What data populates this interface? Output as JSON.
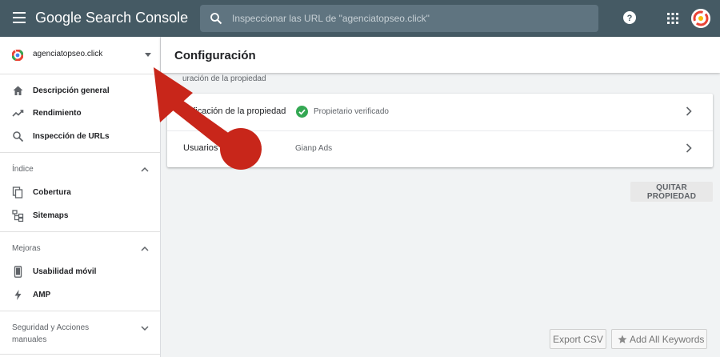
{
  "app": {
    "brand": "Google Search Console"
  },
  "search": {
    "placeholder": "Inspeccionar las URL de \"agenciatopseo.click\""
  },
  "property": {
    "name": "agenciatopseo.click"
  },
  "sidebar": {
    "items": [
      {
        "label": "Descripción general",
        "icon": "home-icon"
      },
      {
        "label": "Rendimiento",
        "icon": "trending-up-icon"
      },
      {
        "label": "Inspección de URLs",
        "icon": "search-icon"
      }
    ],
    "sections": [
      {
        "label": "Índice",
        "items": [
          {
            "label": "Cobertura",
            "icon": "copy-icon"
          },
          {
            "label": "Sitemaps",
            "icon": "sitemap-icon"
          }
        ]
      },
      {
        "label": "Mejoras",
        "items": [
          {
            "label": "Usabilidad móvil",
            "icon": "smartphone-icon"
          },
          {
            "label": "AMP",
            "icon": "bolt-icon"
          }
        ]
      },
      {
        "label": "Seguridad y Acciones manuales"
      }
    ]
  },
  "page": {
    "title": "Configuración",
    "section_title": "uración de la propiedad"
  },
  "card": {
    "rows": [
      {
        "label": "erificación de la propiedad",
        "value": "Propietario verificado",
        "icon": "check-circle-icon"
      },
      {
        "label": "Usuarios",
        "label_tail": "s",
        "value": "Gianp Ads"
      }
    ]
  },
  "buttons": {
    "remove_property": "QUITAR PROPIEDAD",
    "export_csv": "Export CSV",
    "add_keywords": "Add All Keywords"
  },
  "colors": {
    "topbar": "#455a64",
    "annotation": "#c8261a",
    "check": "#34a853"
  }
}
